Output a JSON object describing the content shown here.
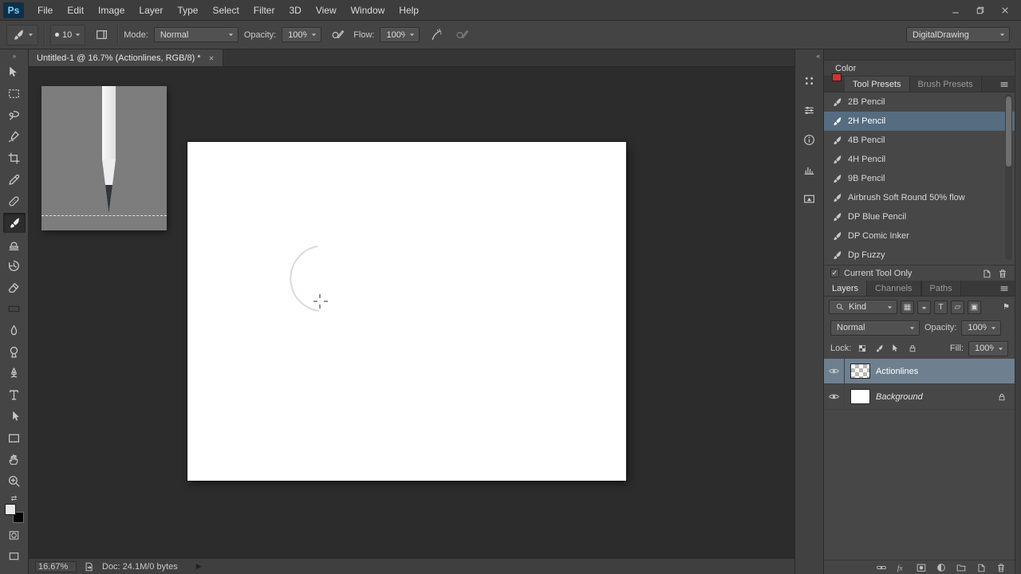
{
  "window": {
    "logo": "Ps"
  },
  "menu": {
    "items": [
      "File",
      "Edit",
      "Image",
      "Layer",
      "Type",
      "Select",
      "Filter",
      "3D",
      "View",
      "Window",
      "Help"
    ]
  },
  "options_bar": {
    "brush_size": "10",
    "mode_label": "Mode:",
    "mode_value": "Normal",
    "opacity_label": "Opacity:",
    "opacity_value": "100%",
    "flow_label": "Flow:",
    "flow_value": "100%",
    "workspace": "DigitalDrawing"
  },
  "document": {
    "tab_title": "Untitled-1 @ 16.7% (Actionlines, RGB/8) *"
  },
  "color_panel": {
    "title": "Color",
    "swatch_color": "#d0342c"
  },
  "tool_presets": {
    "tabs": [
      "Tool Presets",
      "Brush Presets"
    ],
    "active_tab": "Tool Presets",
    "items": [
      "2B Pencil",
      "2H Pencil",
      "4B Pencil",
      "4H Pencil",
      "9B Pencil",
      "Airbrush Soft Round 50% flow",
      "DP Blue Pencil",
      "DP Comic Inker",
      "Dp Fuzzy"
    ],
    "selected_item": "2H Pencil",
    "selected_index": 1,
    "current_tool_only_label": "Current Tool Only",
    "current_tool_only_checked": true
  },
  "layers_panel": {
    "tabs": [
      "Layers",
      "Channels",
      "Paths"
    ],
    "active_tab": "Layers",
    "filter_label": "Kind",
    "blend_mode": "Normal",
    "opacity_label": "Opacity:",
    "opacity_value": "100%",
    "lock_label": "Lock:",
    "fill_label": "Fill:",
    "fill_value": "100%",
    "layers": [
      {
        "name": "Actionlines",
        "visible": true,
        "selected": true
      },
      {
        "name": "Background",
        "visible": true,
        "locked": true
      }
    ]
  },
  "status_bar": {
    "zoom": "16.67%",
    "doc_info": "Doc: 24.1M/0 bytes"
  },
  "icons": {
    "check": "✓",
    "chev_left": "«",
    "chev_right": "»",
    "swap": "⇄",
    "play": "▶",
    "pixel_filter": "▦",
    "adjustment_filter": "◒",
    "type_filter": "T",
    "shape_filter": "▱",
    "smart_filter": "▣",
    "filter_toggle": "⚑"
  },
  "colors": {
    "preset_selection": "#566c80",
    "layer_selection": "#6e8090",
    "canvas": "#ffffff"
  }
}
